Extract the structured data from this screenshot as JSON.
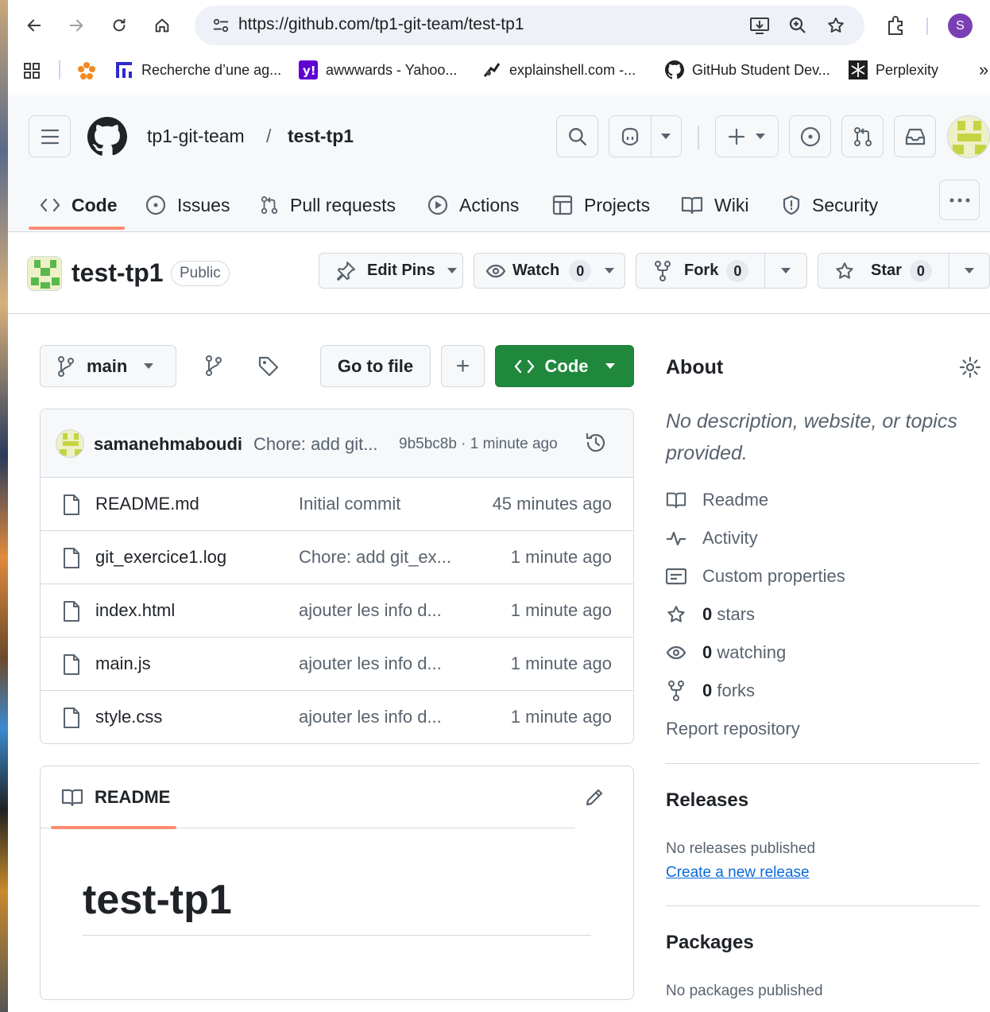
{
  "browser": {
    "url": "https://github.com/tp1-git-team/test-tp1",
    "profile_initial": "S",
    "bookmarks": [
      {
        "label": "Recherche d’une ag..."
      },
      {
        "label": "awwwards - Yahoo..."
      },
      {
        "label": "explainshell.com -..."
      },
      {
        "label": "GitHub Student Dev..."
      },
      {
        "label": "Perplexity"
      }
    ],
    "more_bookmarks": "»"
  },
  "header": {
    "owner": "tp1-git-team",
    "separator": "/",
    "repo": "test-tp1"
  },
  "tabs": [
    {
      "label": "Code",
      "icon": "code-icon",
      "active": true
    },
    {
      "label": "Issues",
      "icon": "issue-icon"
    },
    {
      "label": "Pull requests",
      "icon": "pull-request-icon"
    },
    {
      "label": "Actions",
      "icon": "play-icon"
    },
    {
      "label": "Projects",
      "icon": "table-icon"
    },
    {
      "label": "Wiki",
      "icon": "book-icon"
    },
    {
      "label": "Security",
      "icon": "shield-icon"
    }
  ],
  "repo_header": {
    "name": "test-tp1",
    "visibility": "Public",
    "edit_pins": "Edit Pins",
    "watch": "Watch",
    "watch_count": "0",
    "fork": "Fork",
    "fork_count": "0",
    "star": "Star",
    "star_count": "0"
  },
  "toolbar": {
    "branch": "main",
    "go_to_file": "Go to file",
    "add": "+",
    "code": "Code"
  },
  "latest_commit": {
    "author": "samanehmaboudi",
    "message": "Chore: add git...",
    "meta": "9b5bc8b · 1 minute ago"
  },
  "files": [
    {
      "name": "README.md",
      "message": "Initial commit",
      "age": "45 minutes ago"
    },
    {
      "name": "git_exercice1.log",
      "message": "Chore: add git_ex...",
      "age": "1 minute ago"
    },
    {
      "name": "index.html",
      "message": "ajouter les info d...",
      "age": "1 minute ago"
    },
    {
      "name": "main.js",
      "message": "ajouter les info d...",
      "age": "1 minute ago"
    },
    {
      "name": "style.css",
      "message": "ajouter les info d...",
      "age": "1 minute ago"
    }
  ],
  "readme": {
    "tab": "README",
    "heading": "test-tp1"
  },
  "about": {
    "title": "About",
    "description": "No description, website, or topics provided.",
    "readme": "Readme",
    "activity": "Activity",
    "custom_properties": "Custom properties",
    "stars_count": "0",
    "stars_label": "stars",
    "watching_count": "0",
    "watching_label": "watching",
    "forks_count": "0",
    "forks_label": "forks",
    "report": "Report repository"
  },
  "releases": {
    "title": "Releases",
    "none": "No releases published",
    "create": "Create a new release"
  },
  "packages": {
    "title": "Packages",
    "none": "No packages published"
  },
  "colors": {
    "accent_underline": "#fd8c73",
    "code_button": "#1f883d",
    "link": "#0969da"
  }
}
